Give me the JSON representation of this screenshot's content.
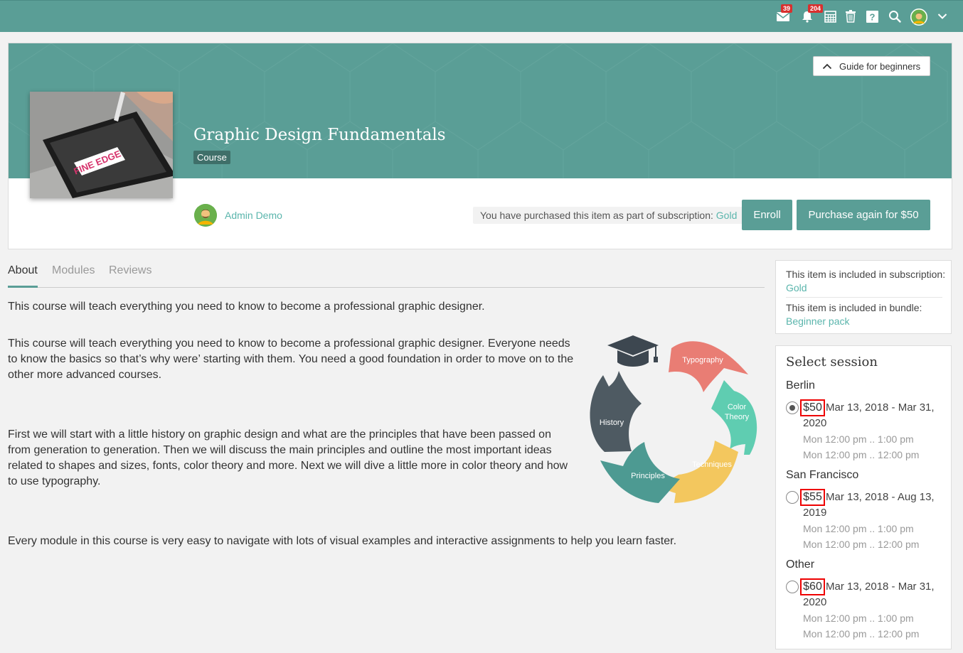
{
  "topbar": {
    "messages_count": "39",
    "notifications_count": "204"
  },
  "header": {
    "guide_label": "Guide for beginners",
    "title": "Graphic Design Fundamentals",
    "badge": "Course",
    "author": "Admin Demo",
    "purchase_note_prefix": "You have purchased this item as part of subscription:",
    "purchase_note_link": "Gold",
    "enroll_label": "Enroll",
    "purchase_again_label": "Purchase again for $50"
  },
  "tabs": [
    {
      "label": "About"
    },
    {
      "label": "Modules"
    },
    {
      "label": "Reviews"
    }
  ],
  "about": {
    "intro": "This course will teach everything you need to know to become a professional graphic designer.",
    "para1": "This course will teach everything you need to know to become a professional graphic designer. Everyone needs to know the basics so that’s why were’ starting with them. You need a good foundation in order to move on to the other more advanced courses.",
    "para2": "First we will start with a little history on graphic design and what are the principles that have been passed on from generation to generation. Then we will discuss the main principles and outline the most important ideas related to shapes and sizes, fonts, color theory and more. Next we will dive a little more in color theory and how to use typography.",
    "para3": "Every module in this course is very easy to navigate with lots of visual examples and interactive assignments to help you learn faster.",
    "diagram": {
      "typography": "Typography",
      "color_theory_1": "Color",
      "color_theory_2": "Theory",
      "techniques": "Techniques",
      "principles": "Principles",
      "history": "History"
    }
  },
  "sidebar": {
    "subscription_prefix": "This item is included in subscription:",
    "subscription_link": "Gold",
    "bundle_prefix": "This item is included in bundle:",
    "bundle_link": "Beginner pack",
    "select_session_title": "Select session",
    "sessions": [
      {
        "city": "Berlin",
        "price": "$50",
        "dates": "Mar 13, 2018 - Mar 31, 2020",
        "time1": "Mon 12:00 pm .. 1:00 pm",
        "time2": "Mon 12:00 pm .. 12:00 pm",
        "selected": true
      },
      {
        "city": "San Francisco",
        "price": "$55",
        "dates": "Mar 13, 2018 - Aug 13, 2019",
        "time1": "Mon 12:00 pm .. 1:00 pm",
        "time2": "Mon 12:00 pm .. 12:00 pm",
        "selected": false
      },
      {
        "city": "Other",
        "price": "$60",
        "dates": "Mar 13, 2018 - Mar 31, 2020",
        "time1": "Mon 12:00 pm .. 1:00 pm",
        "time2": "Mon 12:00 pm .. 12:00 pm",
        "selected": false
      }
    ]
  },
  "colors": {
    "brand": "#5a9e96",
    "link": "#5ab5ac",
    "badge_red": "#d9302f",
    "highlight_red": "#e00000"
  },
  "icons": [
    "mail-icon",
    "bell-icon",
    "calendar-icon",
    "trash-icon",
    "help-icon",
    "search-icon",
    "user-avatar",
    "chevron-down-icon",
    "chevron-up-icon",
    "graduation-cap-icon"
  ]
}
